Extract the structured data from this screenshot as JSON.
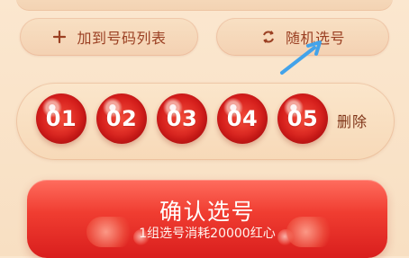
{
  "actions": {
    "add_to_list": "加到号码列表",
    "random_pick": "随机选号"
  },
  "selection": {
    "numbers": [
      "01",
      "02",
      "03",
      "04",
      "05"
    ],
    "delete_label": "删除"
  },
  "confirm": {
    "title": "确认选号",
    "subtitle": "1组选号消耗20000红心"
  },
  "icons": {
    "add": "plus-icon",
    "random": "refresh-icon",
    "annotation": "arrow-icon"
  },
  "colors": {
    "background": "#f8dfc2",
    "button_text": "#9b4023",
    "ball_red": "#d61f1c",
    "confirm_red": "#e32c25",
    "arrow_blue": "#43a3ea"
  }
}
